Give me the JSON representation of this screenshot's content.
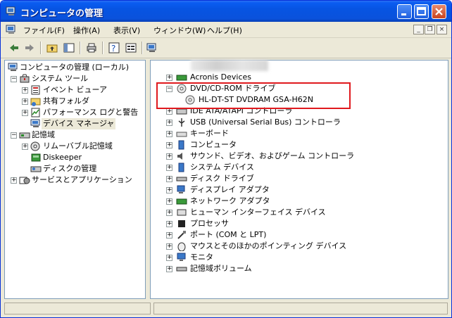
{
  "window": {
    "title": "コンピュータの管理"
  },
  "menu": [
    "ファイル(F)",
    "操作(A)",
    "表示(V)",
    "ウィンドウ(W)",
    "ヘルプ(H)"
  ],
  "mdi_buttons": [
    "_",
    "❐",
    "×"
  ],
  "toolbar_icons": [
    "back-arrow-icon",
    "forward-arrow-icon",
    "up-folder-icon",
    "show-hide-tree-icon",
    "print-icon",
    "help-icon",
    "properties-icon",
    "scan-hardware-icon"
  ],
  "left_tree": [
    {
      "label": "コンピュータの管理 (ローカル)"
    },
    {
      "label": "システム ツール"
    },
    {
      "label": "イベント ビューア"
    },
    {
      "label": "共有フォルダ"
    },
    {
      "label": "パフォーマンス ログと警告"
    },
    {
      "label": "デバイス マネージャ"
    },
    {
      "label": "記憶域"
    },
    {
      "label": "リムーバブル記憶域"
    },
    {
      "label": "Diskeeper"
    },
    {
      "label": "ディスクの管理"
    },
    {
      "label": "サービスとアプリケーション"
    }
  ],
  "right_tree": [
    {
      "label": "Acronis Devices"
    },
    {
      "label": "DVD/CD-ROM ドライブ"
    },
    {
      "label": "HL-DT-ST DVDRAM GSA-H62N"
    },
    {
      "label": "IDE ATA/ATAPI コントローラ"
    },
    {
      "label": "USB (Universal Serial Bus) コントローラ"
    },
    {
      "label": "キーボード"
    },
    {
      "label": "コンピュータ"
    },
    {
      "label": "サウンド、ビデオ、およびゲーム コントローラ"
    },
    {
      "label": "システム デバイス"
    },
    {
      "label": "ディスク ドライブ"
    },
    {
      "label": "ディスプレイ アダプタ"
    },
    {
      "label": "ネットワーク アダプタ"
    },
    {
      "label": "ヒューマン インターフェイス デバイス"
    },
    {
      "label": "プロセッサ"
    },
    {
      "label": "ポート (COM と LPT)"
    },
    {
      "label": "マウスとそのほかのポインティング デバイス"
    },
    {
      "label": "モニタ"
    },
    {
      "label": "記憶域ボリューム"
    }
  ],
  "colors": {
    "highlight": "#e0191e",
    "titlebar": "#0a52dc"
  }
}
